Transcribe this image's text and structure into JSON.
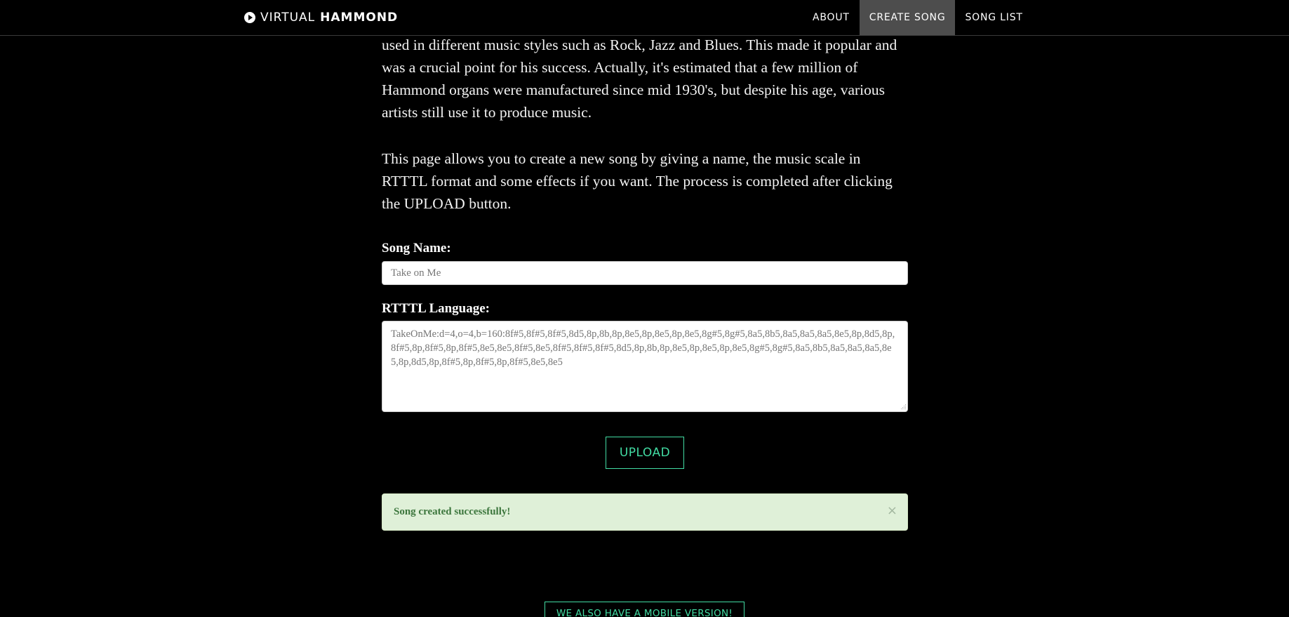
{
  "navbar": {
    "brand_light": "VIRTUAL",
    "brand_bold": "HAMMOND",
    "links": [
      {
        "label": "ABOUT",
        "active": false
      },
      {
        "label": "CREATE SONG",
        "active": true
      },
      {
        "label": "SONG LIST",
        "active": false
      }
    ]
  },
  "intro": {
    "paragraph_1": "used in different music styles such as Rock, Jazz and Blues. This made it popular and was a crucial point for his success. Actually, it's estimated that a few million of Hammond organs were manufactured since mid 1930's, but despite his age, various artists still use it to produce music.",
    "paragraph_2": "This page allows you to create a new song by giving a name, the music scale in RTTTL format and some effects if you want. The process is completed after clicking the UPLOAD button."
  },
  "form": {
    "song_name_label": "Song Name:",
    "song_name_placeholder": "Take on Me",
    "rtttl_label": "RTTTL Language:",
    "rtttl_placeholder": "TakeOnMe:d=4,o=4,b=160:8f#5,8f#5,8f#5,8d5,8p,8b,8p,8e5,8p,8e5,8p,8e5,8g#5,8g#5,8a5,8b5,8a5,8a5,8a5,8e5,8p,8d5,8p,8f#5,8p,8f#5,8p,8f#5,8e5,8e5,8f#5,8e5,8f#5,8f#5,8f#5,8d5,8p,8b,8p,8e5,8p,8e5,8p,8e5,8g#5,8g#5,8a5,8b5,8a5,8a5,8a5,8e5,8p,8d5,8p,8f#5,8p,8f#5,8p,8f#5,8e5,8e5",
    "upload_label": "UPLOAD"
  },
  "alert": {
    "message": "Song created successfully!",
    "close_glyph": "×",
    "color": "#3c763d",
    "background": "#dff0d8"
  },
  "footer": {
    "mobile_label": "WE ALSO HAVE A MOBILE VERSION!"
  },
  "colors": {
    "accent": "#42dca3",
    "nav_active_bg": "#4d4d4d",
    "background": "#000000"
  },
  "icons": {
    "brand": "play-circle-icon",
    "resize": "resize-grip-icon"
  }
}
